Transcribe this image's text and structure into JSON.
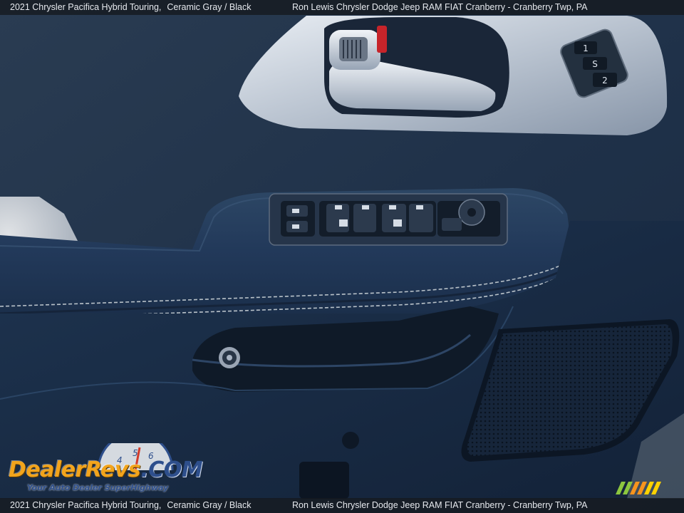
{
  "caption": {
    "vehicle": "2021 Chrysler Pacifica Hybrid Touring,",
    "trim": "Ceramic Gray / Black",
    "dealer": "Ron Lewis Chrysler Dodge Jeep RAM FIAT Cranberry - Cranberry Twp, PA"
  },
  "watermark": {
    "brand_a": "DealerRevs",
    "brand_b": ".COM",
    "tagline": "Your Auto Dealer SuperHighway",
    "gauge_digits": [
      "4",
      "5",
      "6"
    ]
  },
  "memory_seat_buttons": [
    "1",
    "S",
    "2"
  ],
  "colors": {
    "door_panel": "#1f3550",
    "armrest": "#243a55",
    "silver_trim": "#c9d0da",
    "stitching": "#b9c2c9",
    "speaker_grille": "#18283b",
    "watermark_orange": "#f2a41c",
    "watermark_blue": "#2e4f8c"
  }
}
